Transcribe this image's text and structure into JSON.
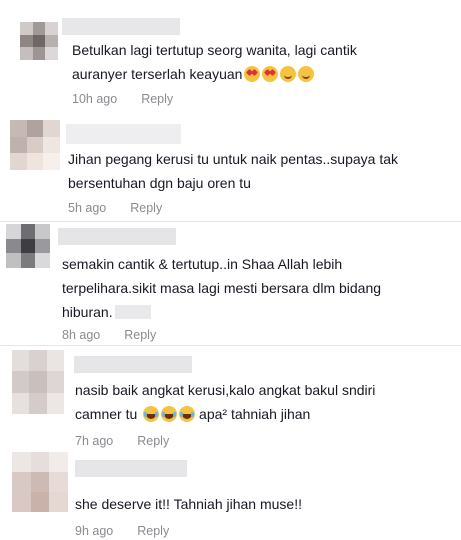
{
  "comments": [
    {
      "lines": [
        "Betulkan lagi tertutup seorg wanita, lagi cantik",
        "auranyer terserlah keayuan"
      ],
      "emojis": [
        "star-struck-emoji",
        "star-struck-emoji",
        "smiling-hearts-emoji",
        "smiling-hearts-emoji"
      ],
      "time": "10h ago",
      "reply": "Reply"
    },
    {
      "lines": [
        "Jihan pegang kerusi tu untuk naik pentas..supaya tak",
        "bersentuhan dgn baju oren tu"
      ],
      "time": "5h ago",
      "reply": "Reply"
    },
    {
      "lines": [
        "semakin cantik & tertutup..in Shaa Allah lebih",
        "terpelihara.sikit masa lagi mesti bersara dlm bidang",
        "hiburan."
      ],
      "time": "8h ago",
      "reply": "Reply"
    },
    {
      "lines": [
        "nasib baik angkat kerusi,kalo angkat bakul sndiri",
        "camner tu"
      ],
      "emojis": [
        "tears-of-joy-emoji",
        "tears-of-joy-emoji",
        "tears-of-joy-emoji"
      ],
      "tail": " apa² tahniah jihan",
      "time": "7h ago",
      "reply": "Reply"
    },
    {
      "lines": [
        "she deserve it!! Tahniah jihan muse!!"
      ],
      "time": "9h ago",
      "reply": "Reply"
    }
  ],
  "colors": {
    "text": "#161823",
    "meta": "#8a8b91",
    "divider": "#e8e8ea",
    "background": "#ffffff"
  }
}
